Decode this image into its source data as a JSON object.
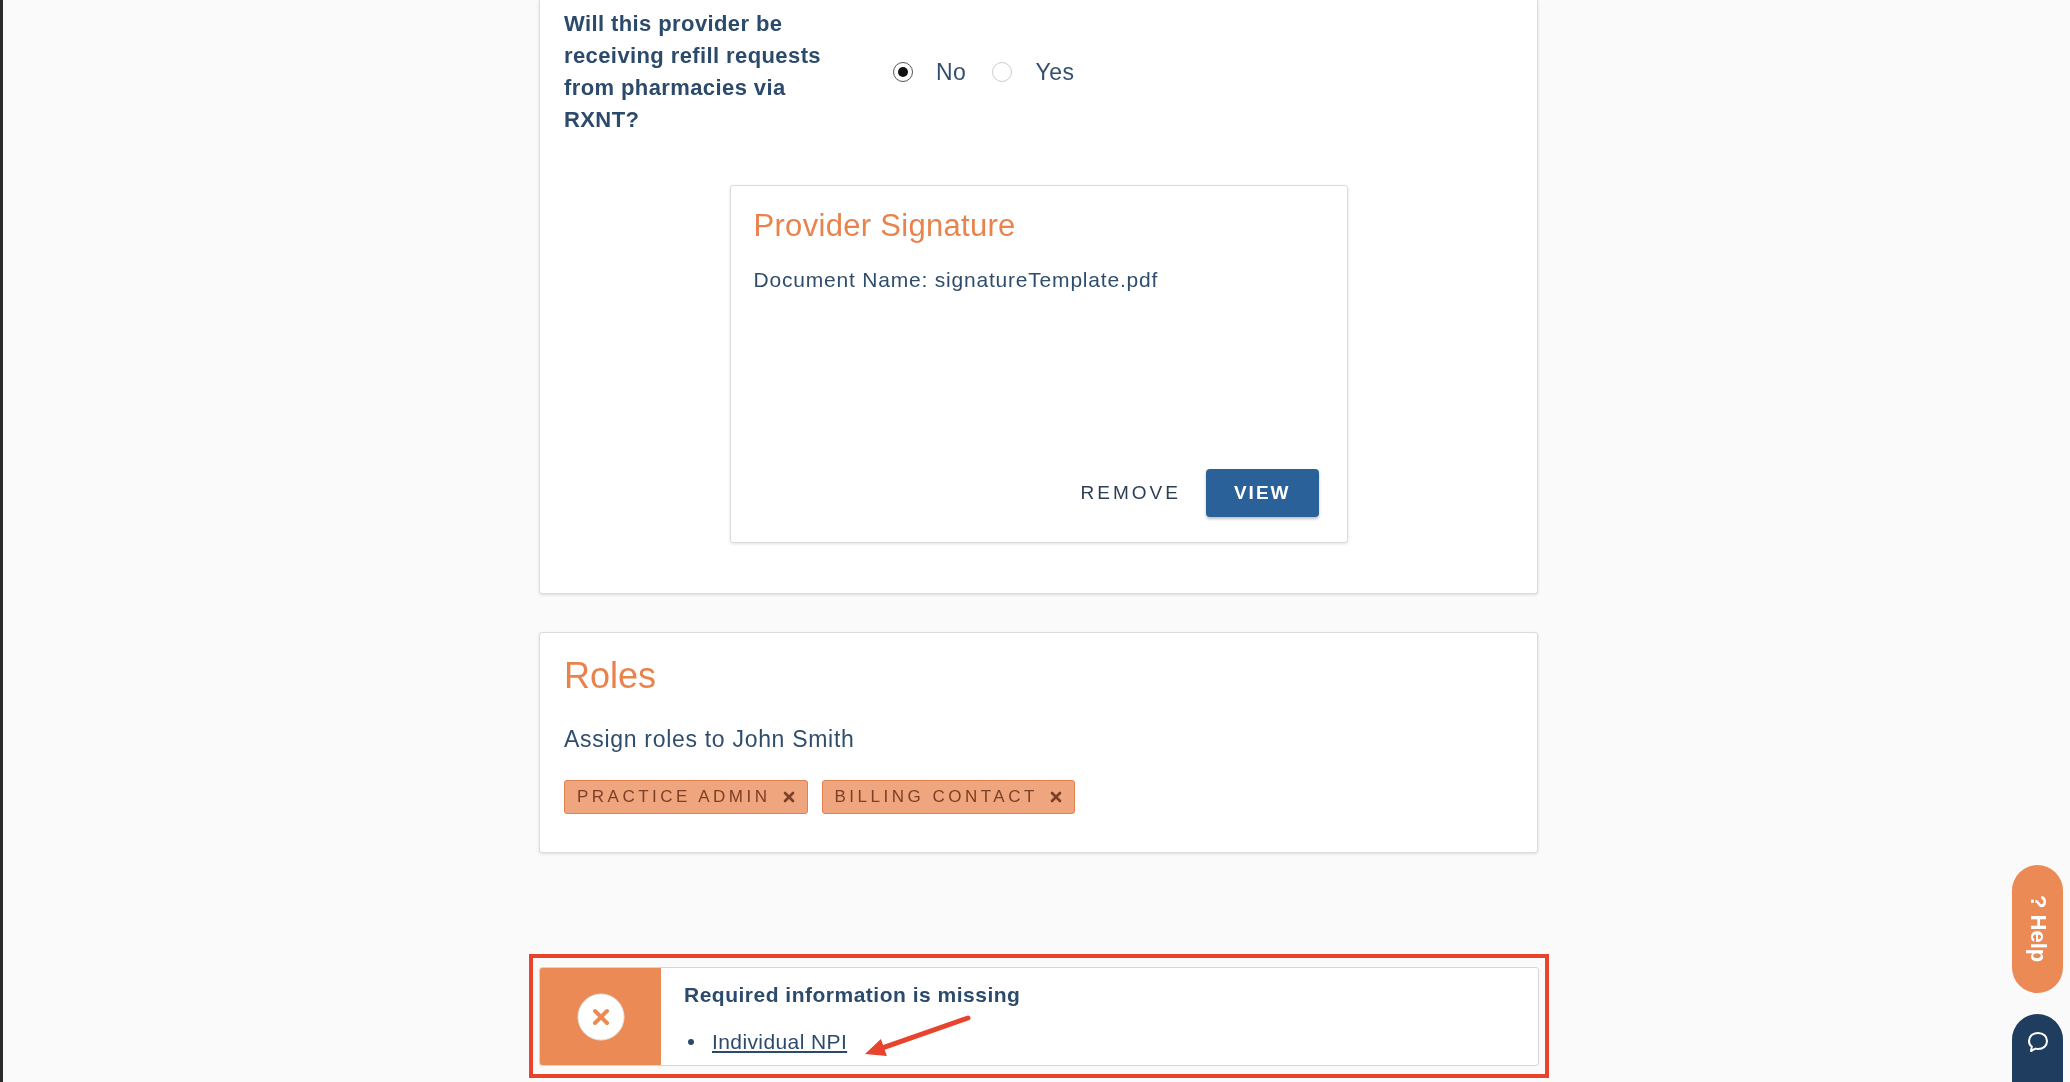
{
  "refill_question": {
    "question": "Will this provider be receiving refill requests from pharmacies via RXNT?",
    "options": [
      {
        "label": "No",
        "selected": true
      },
      {
        "label": "Yes",
        "selected": false
      }
    ]
  },
  "provider_signature": {
    "title": "Provider Signature",
    "document_name": "Document Name: signatureTemplate.pdf",
    "actions": [
      {
        "label": "REMOVE",
        "kind": "text"
      },
      {
        "label": "VIEW",
        "kind": "primary"
      }
    ]
  },
  "roles": {
    "title": "Roles",
    "description": "Assign roles to John Smith",
    "tags": [
      {
        "label": "PRACTICE ADMIN"
      },
      {
        "label": "BILLING CONTACT"
      }
    ]
  },
  "missing_info_alert": {
    "title": "Required information is missing",
    "items": [
      {
        "label": "Individual NPI"
      }
    ]
  },
  "help_tab": {
    "label": "? Help"
  }
}
